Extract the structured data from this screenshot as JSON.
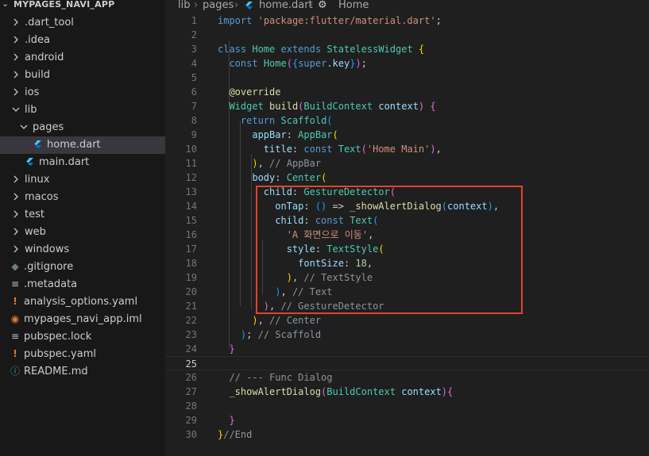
{
  "sidebar": {
    "title": "MYPAGES_NAVI_APP",
    "items": [
      {
        "label": ".dart_tool",
        "kind": "folder",
        "open": false,
        "depth": 0
      },
      {
        "label": ".idea",
        "kind": "folder",
        "open": false,
        "depth": 0
      },
      {
        "label": "android",
        "kind": "folder",
        "open": false,
        "depth": 0
      },
      {
        "label": "build",
        "kind": "folder",
        "open": false,
        "depth": 0
      },
      {
        "label": "ios",
        "kind": "folder",
        "open": false,
        "depth": 0
      },
      {
        "label": "lib",
        "kind": "folder",
        "open": true,
        "depth": 0
      },
      {
        "label": "pages",
        "kind": "folder",
        "open": true,
        "depth": 1
      },
      {
        "label": "home.dart",
        "kind": "dart",
        "depth": 2,
        "selected": true
      },
      {
        "label": "main.dart",
        "kind": "dart",
        "depth": 1
      },
      {
        "label": "linux",
        "kind": "folder",
        "open": false,
        "depth": 0
      },
      {
        "label": "macos",
        "kind": "folder",
        "open": false,
        "depth": 0
      },
      {
        "label": "test",
        "kind": "folder",
        "open": false,
        "depth": 0
      },
      {
        "label": "web",
        "kind": "folder",
        "open": false,
        "depth": 0
      },
      {
        "label": "windows",
        "kind": "folder",
        "open": false,
        "depth": 0
      },
      {
        "label": ".gitignore",
        "kind": "gitignore",
        "depth": 0
      },
      {
        "label": ".metadata",
        "kind": "lines",
        "depth": 0
      },
      {
        "label": "analysis_options.yaml",
        "kind": "yaml",
        "depth": 0
      },
      {
        "label": "mypages_navi_app.iml",
        "kind": "iml",
        "depth": 0
      },
      {
        "label": "pubspec.lock",
        "kind": "lines",
        "depth": 0
      },
      {
        "label": "pubspec.yaml",
        "kind": "yaml",
        "depth": 0
      },
      {
        "label": "README.md",
        "kind": "info",
        "depth": 0
      }
    ]
  },
  "breadcrumb": {
    "part1": "lib",
    "part2": "pages",
    "part3": "home.dart",
    "part4": "Home"
  },
  "editor": {
    "current_line": 25,
    "lines": [
      [
        [
          "kw",
          "import"
        ],
        [
          "pu",
          " "
        ],
        [
          "st",
          "'package:flutter/material.dart'"
        ],
        [
          "pu",
          ";"
        ]
      ],
      [],
      [
        [
          "kw",
          "class"
        ],
        [
          "pu",
          " "
        ],
        [
          "ty",
          "Home"
        ],
        [
          "pu",
          " "
        ],
        [
          "kw",
          "extends"
        ],
        [
          "pu",
          " "
        ],
        [
          "ty",
          "StatelessWidget"
        ],
        [
          "pu",
          " "
        ],
        [
          "b1",
          "{"
        ]
      ],
      [
        [
          "pu",
          "  "
        ],
        [
          "kw",
          "const"
        ],
        [
          "pu",
          " "
        ],
        [
          "ty",
          "Home"
        ],
        [
          "b2",
          "("
        ],
        [
          "b3",
          "{"
        ],
        [
          "kw",
          "super"
        ],
        [
          "pu",
          "."
        ],
        [
          "pr",
          "key"
        ],
        [
          "b3",
          "}"
        ],
        [
          "b2",
          ")"
        ],
        [
          "pu",
          ";"
        ]
      ],
      [],
      [
        [
          "pu",
          "  "
        ],
        [
          "an",
          "@override"
        ]
      ],
      [
        [
          "pu",
          "  "
        ],
        [
          "ty",
          "Widget"
        ],
        [
          "pu",
          " "
        ],
        [
          "fn",
          "build"
        ],
        [
          "b2",
          "("
        ],
        [
          "ty",
          "BuildContext"
        ],
        [
          "pu",
          " "
        ],
        [
          "pr",
          "context"
        ],
        [
          "b2",
          ")"
        ],
        [
          "pu",
          " "
        ],
        [
          "b2",
          "{"
        ]
      ],
      [
        [
          "pu",
          "    "
        ],
        [
          "kw",
          "return"
        ],
        [
          "pu",
          " "
        ],
        [
          "ty",
          "Scaffold"
        ],
        [
          "b3",
          "("
        ]
      ],
      [
        [
          "pu",
          "      "
        ],
        [
          "pr",
          "appBar"
        ],
        [
          "pu",
          ": "
        ],
        [
          "ty",
          "AppBar"
        ],
        [
          "b1",
          "("
        ]
      ],
      [
        [
          "pu",
          "        "
        ],
        [
          "pr",
          "title"
        ],
        [
          "pu",
          ": "
        ],
        [
          "kw",
          "const"
        ],
        [
          "pu",
          " "
        ],
        [
          "ty",
          "Text"
        ],
        [
          "b2",
          "("
        ],
        [
          "st",
          "'Home Main'"
        ],
        [
          "b2",
          ")"
        ],
        [
          "pu",
          ","
        ]
      ],
      [
        [
          "pu",
          "      "
        ],
        [
          "b1",
          ")"
        ],
        [
          "pu",
          ", "
        ],
        [
          "cm",
          "// AppBar"
        ]
      ],
      [
        [
          "pu",
          "      "
        ],
        [
          "pr",
          "body"
        ],
        [
          "pu",
          ": "
        ],
        [
          "ty",
          "Center"
        ],
        [
          "b1",
          "("
        ]
      ],
      [
        [
          "pu",
          "        "
        ],
        [
          "pr",
          "child"
        ],
        [
          "pu",
          ": "
        ],
        [
          "ty",
          "GestureDetector"
        ],
        [
          "b2",
          "("
        ]
      ],
      [
        [
          "pu",
          "          "
        ],
        [
          "pr",
          "onTap"
        ],
        [
          "pu",
          ": "
        ],
        [
          "b3",
          "()"
        ],
        [
          "pu",
          " => "
        ],
        [
          "fn",
          "_showAlertDialog"
        ],
        [
          "b3",
          "("
        ],
        [
          "pr",
          "context"
        ],
        [
          "b3",
          ")"
        ],
        [
          "pu",
          ","
        ]
      ],
      [
        [
          "pu",
          "          "
        ],
        [
          "pr",
          "child"
        ],
        [
          "pu",
          ": "
        ],
        [
          "kw",
          "const"
        ],
        [
          "pu",
          " "
        ],
        [
          "ty",
          "Text"
        ],
        [
          "b3",
          "("
        ]
      ],
      [
        [
          "pu",
          "            "
        ],
        [
          "st",
          "'A 화면으로 이동'"
        ],
        [
          "pu",
          ","
        ]
      ],
      [
        [
          "pu",
          "            "
        ],
        [
          "pr",
          "style"
        ],
        [
          "pu",
          ": "
        ],
        [
          "ty",
          "TextStyle"
        ],
        [
          "b1",
          "("
        ]
      ],
      [
        [
          "pu",
          "              "
        ],
        [
          "pr",
          "fontSize"
        ],
        [
          "pu",
          ": "
        ],
        [
          "nm",
          "18"
        ],
        [
          "pu",
          ","
        ]
      ],
      [
        [
          "pu",
          "            "
        ],
        [
          "b1",
          ")"
        ],
        [
          "pu",
          ", "
        ],
        [
          "cm",
          "// TextStyle"
        ]
      ],
      [
        [
          "pu",
          "          "
        ],
        [
          "b3",
          ")"
        ],
        [
          "pu",
          ", "
        ],
        [
          "cm",
          "// Text"
        ]
      ],
      [
        [
          "pu",
          "        "
        ],
        [
          "b2",
          ")"
        ],
        [
          "pu",
          ", "
        ],
        [
          "cm",
          "// GestureDetector"
        ]
      ],
      [
        [
          "pu",
          "      "
        ],
        [
          "b1",
          ")"
        ],
        [
          "pu",
          ", "
        ],
        [
          "cm",
          "// Center"
        ]
      ],
      [
        [
          "pu",
          "    "
        ],
        [
          "b3",
          ")"
        ],
        [
          "pu",
          "; "
        ],
        [
          "cm",
          "// Scaffold"
        ]
      ],
      [
        [
          "pu",
          "  "
        ],
        [
          "b2",
          "}"
        ]
      ],
      [],
      [
        [
          "pu",
          "  "
        ],
        [
          "cm",
          "// --- Func Dialog"
        ]
      ],
      [
        [
          "pu",
          "  "
        ],
        [
          "fn",
          "_showAlertDialog"
        ],
        [
          "b2",
          "("
        ],
        [
          "ty",
          "BuildContext"
        ],
        [
          "pu",
          " "
        ],
        [
          "pr",
          "context"
        ],
        [
          "b2",
          ")"
        ],
        [
          "b2",
          "{"
        ]
      ],
      [],
      [
        [
          "pu",
          "  "
        ],
        [
          "b2",
          "}"
        ]
      ],
      [
        [
          "b1",
          "}"
        ],
        [
          "cm",
          "//End"
        ]
      ]
    ]
  },
  "colors": {
    "highlight_box": "#e0442e",
    "background": "#1f1f1f",
    "sidebar": "#181818",
    "selected_row": "#37373d"
  }
}
